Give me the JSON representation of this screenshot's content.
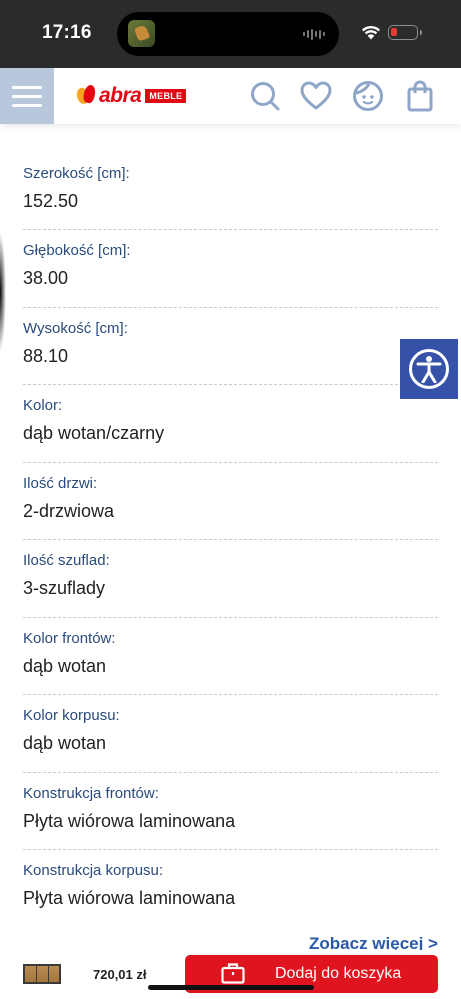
{
  "status_bar": {
    "time": "17:16"
  },
  "header": {
    "logo_text": "abra",
    "logo_badge": "MEBLE",
    "icons": [
      "menu-icon",
      "search-icon",
      "heart-icon",
      "account-icon",
      "bag-icon"
    ]
  },
  "specs": [
    {
      "label": "Szerokość [cm]:",
      "value": "152.50"
    },
    {
      "label": "Głębokość [cm]:",
      "value": "38.00"
    },
    {
      "label": "Wysokość [cm]:",
      "value": "88.10"
    },
    {
      "label": "Kolor:",
      "value": "dąb wotan/czarny"
    },
    {
      "label": "Ilość drzwi:",
      "value": "2-drzwiowa"
    },
    {
      "label": "Ilość szuflad:",
      "value": "3-szuflady"
    },
    {
      "label": "Kolor frontów:",
      "value": "dąb wotan"
    },
    {
      "label": "Kolor korpusu:",
      "value": "dąb wotan"
    },
    {
      "label": "Konstrukcja frontów:",
      "value": "Płyta wiórowa laminowana"
    },
    {
      "label": "Konstrukcja korpusu:",
      "value": "Płyta wiórowa laminowana"
    }
  ],
  "see_more": "Zobacz więcej >",
  "bottom_bar": {
    "price": "720,01 zł",
    "add_to_cart": "Dodaj do koszyka"
  },
  "colors": {
    "brand_red": "#e30613",
    "label_blue": "#2a4b7c",
    "a11y_blue": "#3552a8",
    "cart_red": "#e0141e"
  }
}
